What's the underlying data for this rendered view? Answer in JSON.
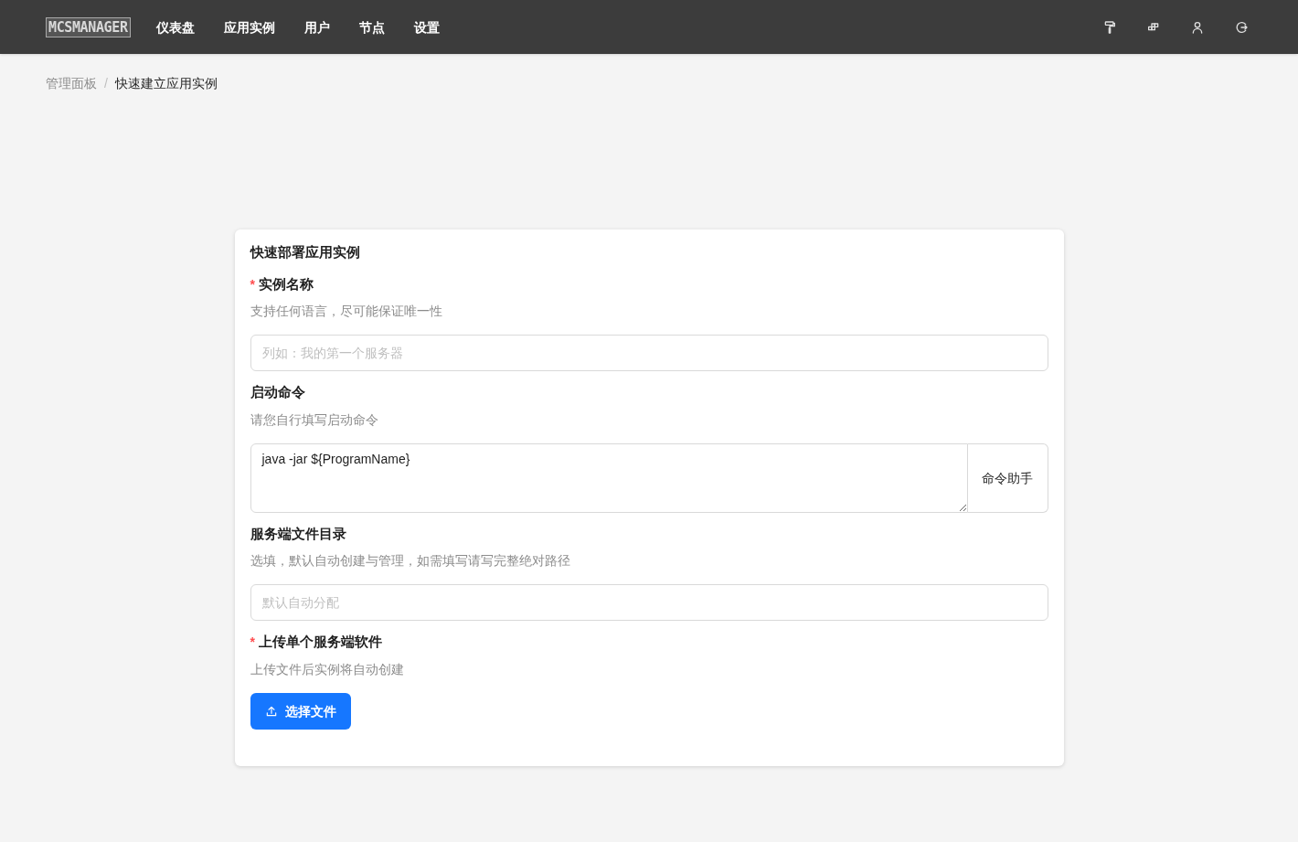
{
  "header": {
    "logo": "MCSMANAGER",
    "nav": [
      "仪表盘",
      "应用实例",
      "用户",
      "节点",
      "设置"
    ]
  },
  "breadcrumb": [
    "管理面板",
    "/",
    "快速建立应用实例"
  ],
  "form": {
    "title": "快速部署应用实例",
    "fields": [
      {
        "kind": "input",
        "label": "实例名称",
        "required_mark": "*",
        "hint": "支持任何语言，尽可能保证唯一性",
        "placeholder": "列如：我的第一个服务器"
      },
      {
        "kind": "textarea",
        "label": "启动命令",
        "hint": "请您自行填写启动命令",
        "value": "java -jar ${ProgramName}",
        "button": "命令助手"
      },
      {
        "kind": "input",
        "label": "服务端文件目录",
        "hint": "选填，默认自动创建与管理，如需填写请写完整绝对路径",
        "placeholder": "默认自动分配"
      },
      {
        "kind": "upload",
        "label": "上传单个服务端软件",
        "required_mark": "*",
        "hint": "上传文件后实例将自动创建",
        "button": "选择文件"
      }
    ]
  }
}
